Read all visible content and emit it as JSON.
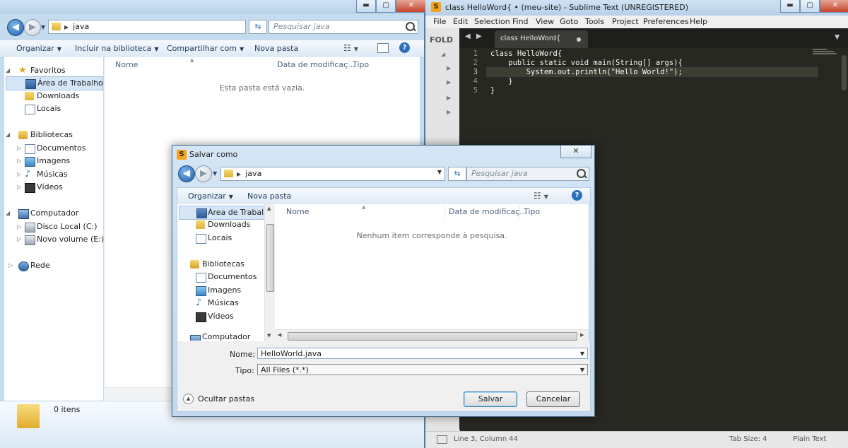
{
  "explorer": {
    "address": {
      "path": "java"
    },
    "search": {
      "placeholder": "Pesquisar java"
    },
    "toolbar": {
      "organize": "Organizar",
      "include_library": "Incluir na biblioteca",
      "share_with": "Compartilhar com",
      "new_folder": "Nova pasta"
    },
    "nav": {
      "favorites": "Favoritos",
      "desktop": "Área de Trabalho",
      "downloads": "Downloads",
      "locals": "Locais",
      "libraries": "Bibliotecas",
      "documents": "Documentos",
      "images": "Imagens",
      "music": "Músicas",
      "videos": "Vídeos",
      "computer": "Computador",
      "local_disk": "Disco Local (C:)",
      "new_volume": "Novo volume (E:)",
      "network": "Rede"
    },
    "columns": {
      "name": "Nome",
      "date": "Data de modificaç...",
      "type": "Tipo"
    },
    "empty_message": "Esta pasta está vazia.",
    "item_count": "0 itens"
  },
  "sublime": {
    "title": "class HelloWord{ • (meu-site) - Sublime Text (UNREGISTERED)",
    "logo_letter": "S",
    "menu": [
      "File",
      "Edit",
      "Selection",
      "Find",
      "View",
      "Goto",
      "Tools",
      "Project",
      "Preferences",
      "Help"
    ],
    "sidebar_label": "FOLD",
    "tab_label": "class HelloWord{",
    "code_lines": [
      {
        "n": "1",
        "text": "class HelloWord{"
      },
      {
        "n": "2",
        "text": "    public static void main(String[] args){"
      },
      {
        "n": "3",
        "text": "        System.out.println(\"Hello World!\");"
      },
      {
        "n": "4",
        "text": "    }"
      },
      {
        "n": "5",
        "text": "}"
      }
    ],
    "status": {
      "position": "Line 3, Column 44",
      "tab_size": "Tab Size: 4",
      "syntax": "Plain Text"
    }
  },
  "dialog": {
    "title": "Salvar como",
    "logo_letter": "S",
    "close_label": "✕",
    "address": {
      "path": "java"
    },
    "search": {
      "placeholder": "Pesquisar java"
    },
    "toolbar": {
      "organize": "Organizar",
      "new_folder": "Nova pasta"
    },
    "nav": {
      "desktop": "Área de Trabalho",
      "downloads": "Downloads",
      "locals": "Locais",
      "libraries": "Bibliotecas",
      "documents": "Documentos",
      "images": "Imagens",
      "music": "Músicas",
      "videos": "Vídeos",
      "computer_partial": "Computador"
    },
    "columns": {
      "name": "Nome",
      "date": "Data de modificaç...",
      "type": "Tipo"
    },
    "empty_message": "Nenhum item corresponde à pesquisa.",
    "filename_label": "Nome:",
    "filename_value": "HelloWorld.java",
    "type_label": "Tipo:",
    "type_value": "All Files (*.*)",
    "hide_folders": "Ocultar pastas",
    "save_button": "Salvar",
    "cancel_button": "Cancelar"
  },
  "colors": {
    "desktop_blue": "#2b6fa8",
    "sublime_bg": "#272822",
    "accent": "#3c7fb1"
  }
}
